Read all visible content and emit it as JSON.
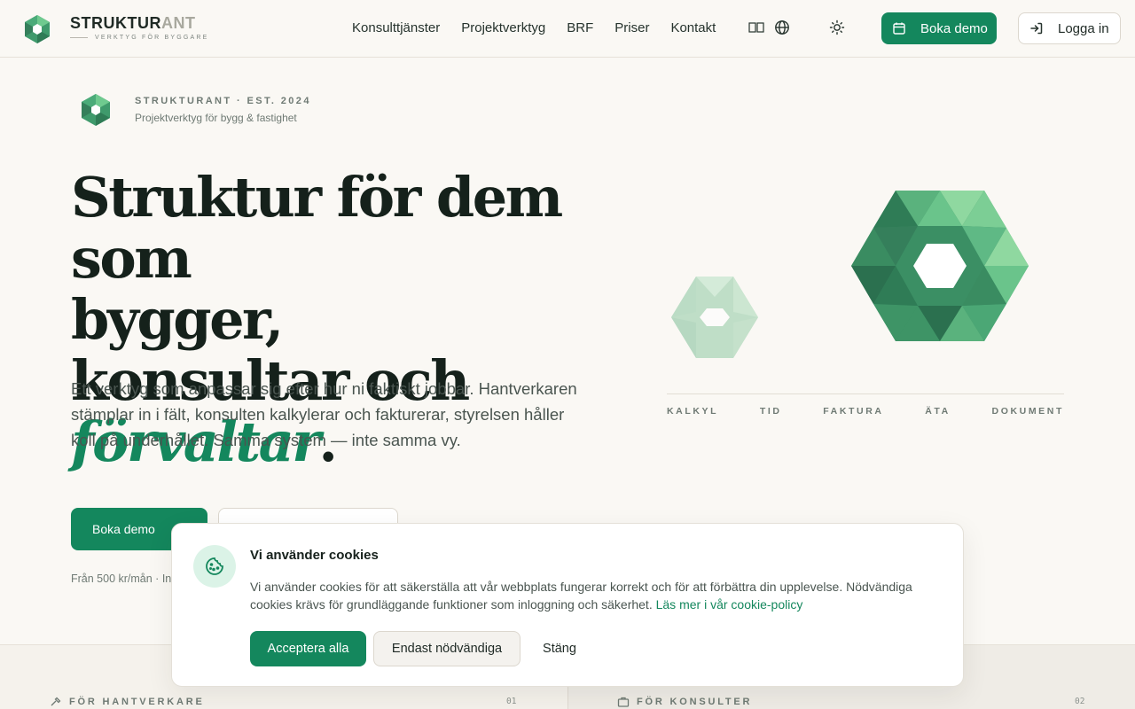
{
  "header": {
    "brand_primary": "STRUKTUR",
    "brand_secondary": "ANT",
    "brand_tagline": "VERKTYG FÖR BYGGARE",
    "nav": [
      "Konsulttjänster",
      "Projektverktyg",
      "BRF",
      "Priser",
      "Kontakt"
    ],
    "book_demo": "Boka demo",
    "login": "Logga in",
    "icons": {
      "flag": "sweden-flag-icon",
      "language": "globe-icon",
      "theme": "sun-icon",
      "calendar": "calendar-icon",
      "login": "login-icon"
    }
  },
  "hero": {
    "eyebrow": "STRUKTURANT · EST. 2024",
    "eyebrow_sub": "Projektverktyg för bygg & fastighet",
    "headline_line1": "Struktur för dem som",
    "headline_line2": "bygger, konsultar och",
    "headline_accent": "förvaltar",
    "headline_end": ".",
    "lead": "Ett verktyg som anpassar sig efter hur ni faktiskt jobbar. Hantverkaren stämplar in i fält, konsulten kalkylerar och fakturerar, styrelsen håller koll på underhållet. Samma system — inte samma vy.",
    "cta_primary": "Boka demo",
    "fine_print": "Från 500 kr/mån · In"
  },
  "illustration": {
    "features": [
      "KALKYL",
      "TID",
      "FAKTURA",
      "ÄTA",
      "DOKUMENT"
    ]
  },
  "band": {
    "left_label": "FÖR HANTVERKARE",
    "left_num": "01",
    "right_label": "FÖR KONSULTER",
    "right_num": "02"
  },
  "cookie": {
    "title": "Vi använder cookies",
    "text": "Vi använder cookies för att säkerställa att vår webbplats fungerar korrekt och för att förbättra din upplevelse. Nödvändiga cookies krävs för grundläggande funktioner som inloggning och säkerhet.",
    "link": "Läs mer i vår cookie-policy",
    "accept": "Acceptera alla",
    "necessary": "Endast nödvändiga",
    "close": "Stäng"
  },
  "colors": {
    "accent": "#14875d",
    "background": "#faf8f4"
  }
}
